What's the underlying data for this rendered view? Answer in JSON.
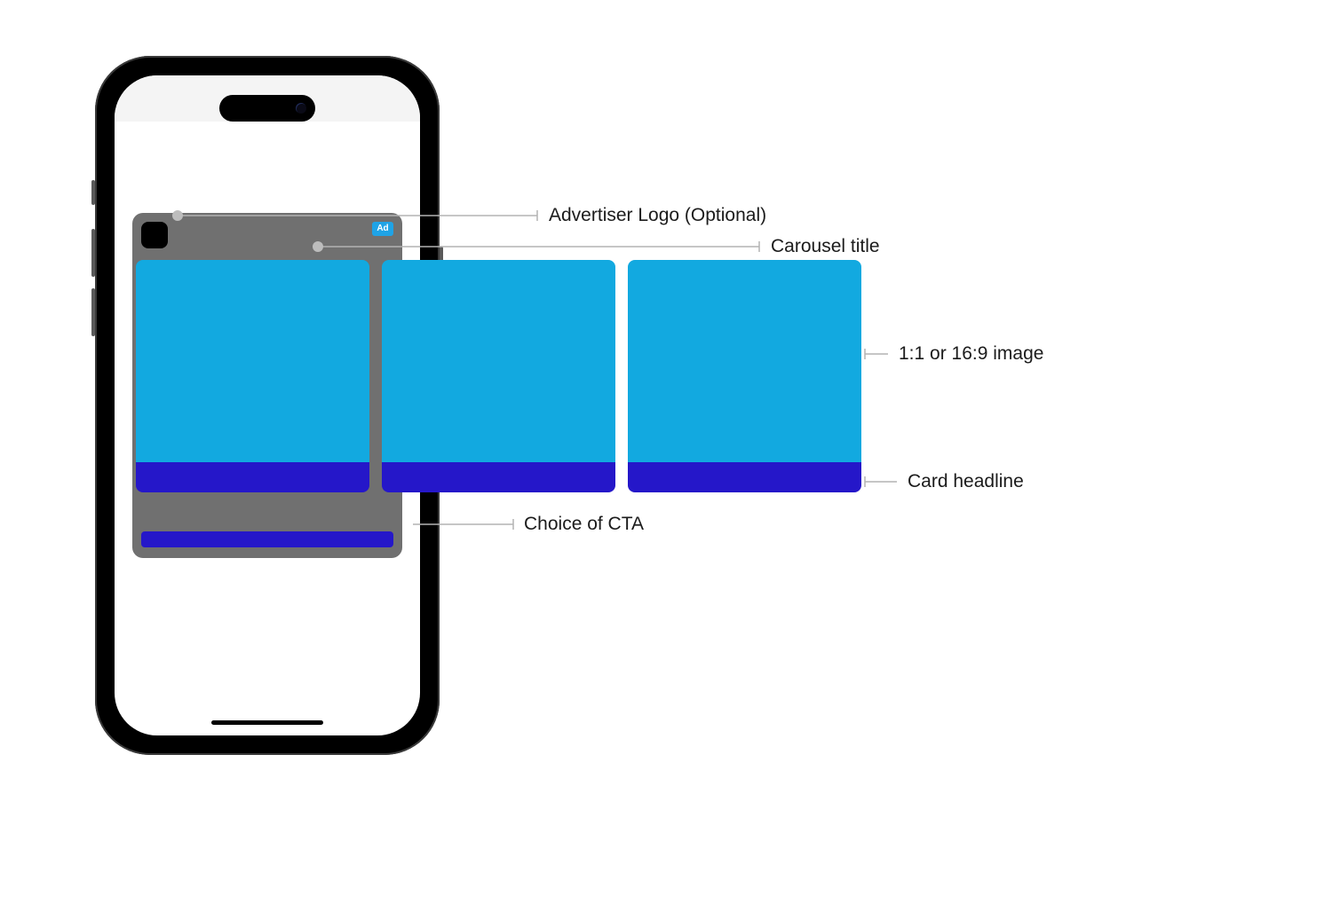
{
  "ad": {
    "badge_text": "Ad"
  },
  "annotations": {
    "advertiser_logo": "Advertiser Logo (Optional)",
    "carousel_title": "Carousel title",
    "image_spec": "1:1 or 16:9 image",
    "card_headline": "Card headline",
    "cta": "Choice of CTA"
  },
  "colors": {
    "card_image": "#12a9e0",
    "card_headline": "#2517c9",
    "ad_panel": "#707070",
    "ad_badge": "#1fa3e6",
    "leader": "#b3b3b3"
  }
}
